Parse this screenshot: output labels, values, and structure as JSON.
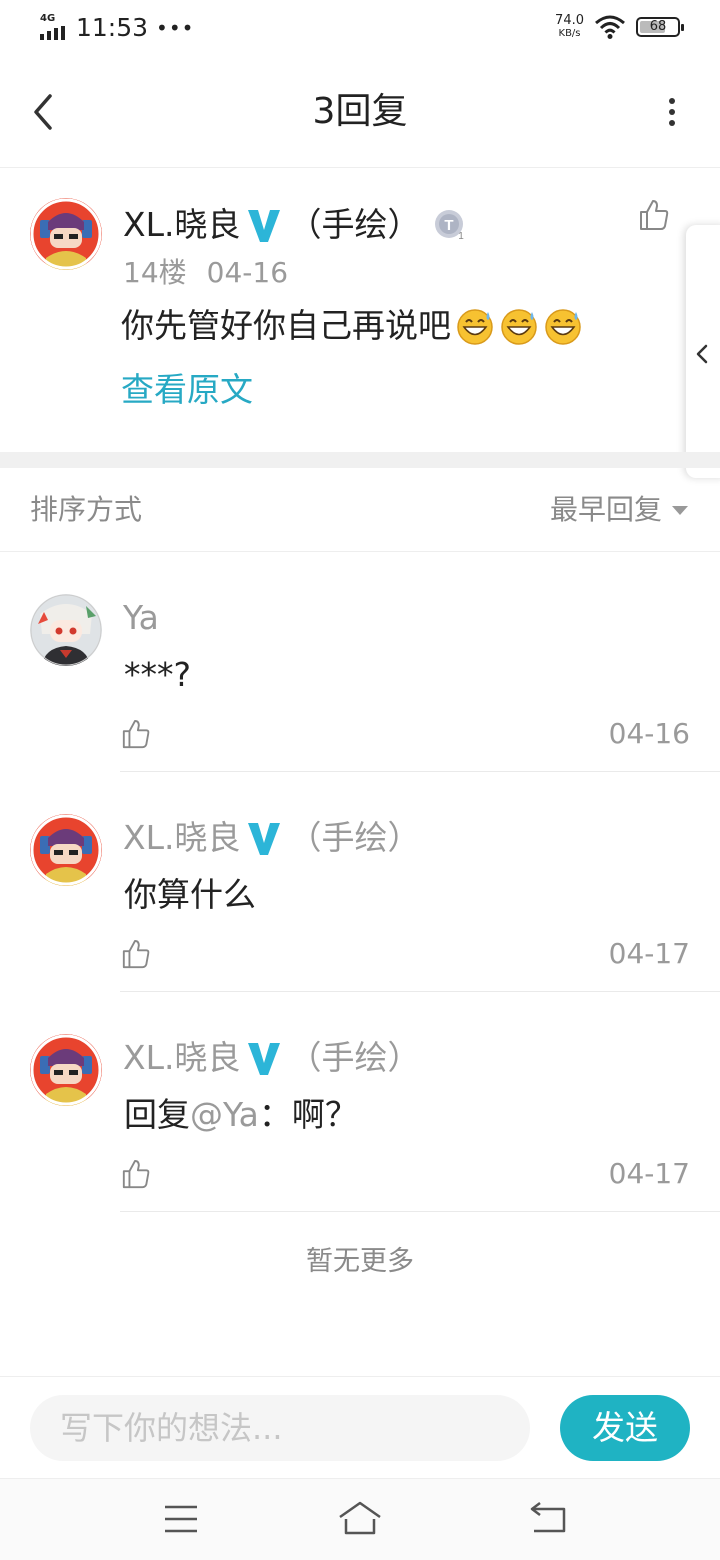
{
  "status_bar": {
    "network": "4G",
    "time": "11:53",
    "dots": "•••",
    "speed_value": "74.0",
    "speed_unit": "KB/s",
    "battery": "68"
  },
  "header": {
    "title": "3回复",
    "back_icon": "chevron-left-icon",
    "more_icon": "more-vertical-icon"
  },
  "main_post": {
    "user_name": "XL.晓良",
    "user_tag": "（手绘）",
    "floor": "14楼",
    "date": "04-16",
    "content": "你先管好你自己再说吧",
    "emojis": [
      "grin-sweat-emoji",
      "grin-sweat-emoji",
      "grin-sweat-emoji"
    ],
    "view_original": "查看原文"
  },
  "sort": {
    "label": "排序方式",
    "selected": "最早回复"
  },
  "replies": [
    {
      "user_name": "Ya",
      "user_tag": "",
      "content": "***?",
      "mention": "",
      "date": "04-16",
      "verified": false
    },
    {
      "user_name": "XL.晓良",
      "user_tag": "（手绘）",
      "content": "你算什么",
      "mention": "",
      "date": "04-17",
      "verified": true
    },
    {
      "user_name": "XL.晓良",
      "user_tag": "（手绘）",
      "content_prefix": "回复",
      "mention": "@Ya",
      "content": "：啊？",
      "date": "04-17",
      "verified": true
    }
  ],
  "no_more": "暂无更多",
  "input": {
    "placeholder": "写下你的想法...",
    "send_label": "发送"
  },
  "colors": {
    "accent": "#1fb3c3",
    "link": "#27a9c4",
    "verified": "#2cb5d8"
  }
}
